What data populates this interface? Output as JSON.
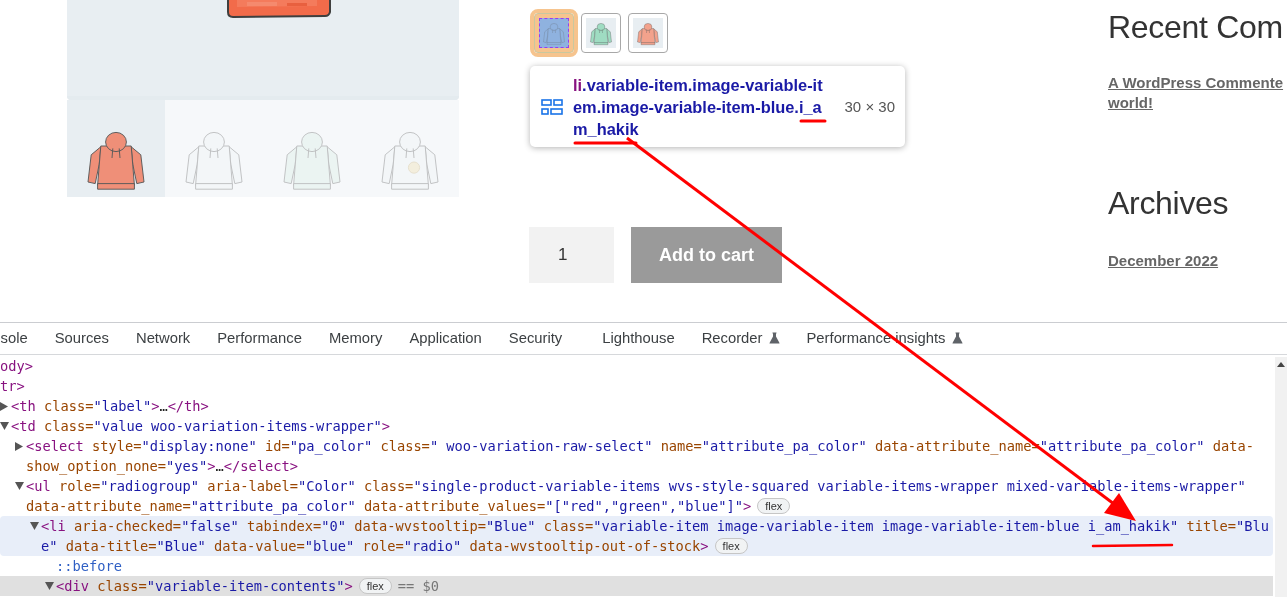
{
  "gallery": {
    "main_image": {
      "kind": "picture"
    },
    "thumbnails": [
      {
        "kind": "picture",
        "selected": true
      },
      {
        "kind": "picture",
        "selected": false
      },
      {
        "kind": "picture",
        "selected": false
      },
      {
        "kind": "picture",
        "selected": false
      }
    ]
  },
  "variation_swatches": [
    {
      "kind": "picture",
      "inspected": true
    },
    {
      "kind": "picture",
      "inspected": false
    },
    {
      "kind": "picture",
      "inspected": false
    }
  ],
  "inspect_tooltip": {
    "tag": "li",
    "class_lines": [
      ".variable-item.image-variable-it",
      "em.image-variable-item-blue.i_a",
      "m_hakik"
    ],
    "size": "30 × 30"
  },
  "quantity": {
    "value": "1"
  },
  "add_to_cart": {
    "label": "Add to cart",
    "disabled": true
  },
  "sidebar": [
    {
      "title": "Recent Com",
      "links": [
        {
          "lines": [
            "A WordPress Commente",
            "world!"
          ]
        }
      ]
    },
    {
      "title": "Archives",
      "links": [
        {
          "lines": [
            "December 2022"
          ]
        }
      ]
    }
  ],
  "devtools": {
    "tabs": [
      {
        "label": "sole",
        "selected": false,
        "experimental": false
      },
      {
        "label": "Sources",
        "selected": false,
        "experimental": false
      },
      {
        "label": "Network",
        "selected": false,
        "experimental": false
      },
      {
        "label": "Performance",
        "selected": false,
        "experimental": false
      },
      {
        "label": "Memory",
        "selected": false,
        "experimental": false
      },
      {
        "label": "Application",
        "selected": false,
        "experimental": false
      },
      {
        "label": "Security",
        "selected": false,
        "experimental": false
      },
      {
        "label": "Lighthouse",
        "selected": false,
        "experimental": false
      },
      {
        "label": "Recorder",
        "selected": false,
        "experimental": true
      },
      {
        "label": "Performance insights",
        "selected": false,
        "experimental": true
      }
    ],
    "tree": [
      {
        "kind": "fragment",
        "lines": [
          "ody>"
        ],
        "selected": false,
        "hovered": false
      },
      {
        "kind": "fragment",
        "lines": [
          "tr>"
        ],
        "selected": false,
        "hovered": false,
        "children": [
          {
            "kind": "element",
            "expanded": false,
            "selected": false,
            "hovered": false,
            "lines": [
              "<th class=\"label\">…</th>"
            ]
          },
          {
            "kind": "element",
            "expanded": true,
            "selected": false,
            "hovered": false,
            "lines": [
              "<td class=\"value woo-variation-items-wrapper\">"
            ],
            "children": [
              {
                "kind": "element",
                "expanded": false,
                "selected": false,
                "hovered": false,
                "lines": [
                  "<select style=\"display:none\" id=\"pa_color\" class=\" woo-variation-raw-select\" name=\"attribute_pa_color\" data-attribute_name=\"attribute_pa_color\" data-",
                  "show_option_none=\"yes\">…</select>"
                ]
              },
              {
                "kind": "element",
                "expanded": true,
                "selected": false,
                "hovered": false,
                "lines": [
                  "<ul role=\"radiogroup\" aria-label=\"Color\" class=\"single-product-variable-items wvs-style-squared variable-items-wrapper mixed-variable-items-wrapper\"",
                  "data-attribute_name=\"attribute_pa_color\" data-attribute_values=\"[\"red\",\"green\",\"blue\"]\">"
                ],
                "badges": [
                  "flex"
                ],
                "children": [
                  {
                    "kind": "element",
                    "expanded": true,
                    "selected": false,
                    "hovered": true,
                    "lines": [
                      "<li aria-checked=\"false\" tabindex=\"0\" data-wvstooltip=\"Blue\" class=\"variable-item image-variable-item image-variable-item-blue i_am_hakik\" title=\"Blu",
                      "e\" data-title=\"Blue\" data-value=\"blue\" role=\"radio\" data-wvstooltip-out-of-stock>"
                    ],
                    "badges": [
                      "flex"
                    ],
                    "children": [
                      {
                        "kind": "pseudo",
                        "selected": false,
                        "hovered": false,
                        "lines": [
                          "::before"
                        ]
                      },
                      {
                        "kind": "element",
                        "expanded": true,
                        "selected": true,
                        "hovered": false,
                        "lines": [
                          "<div class=\"variable-item-contents\">"
                        ],
                        "badges": [
                          "flex"
                        ],
                        "suffix": "== $0"
                      }
                    ]
                  }
                ]
              }
            ]
          }
        ]
      }
    ]
  }
}
